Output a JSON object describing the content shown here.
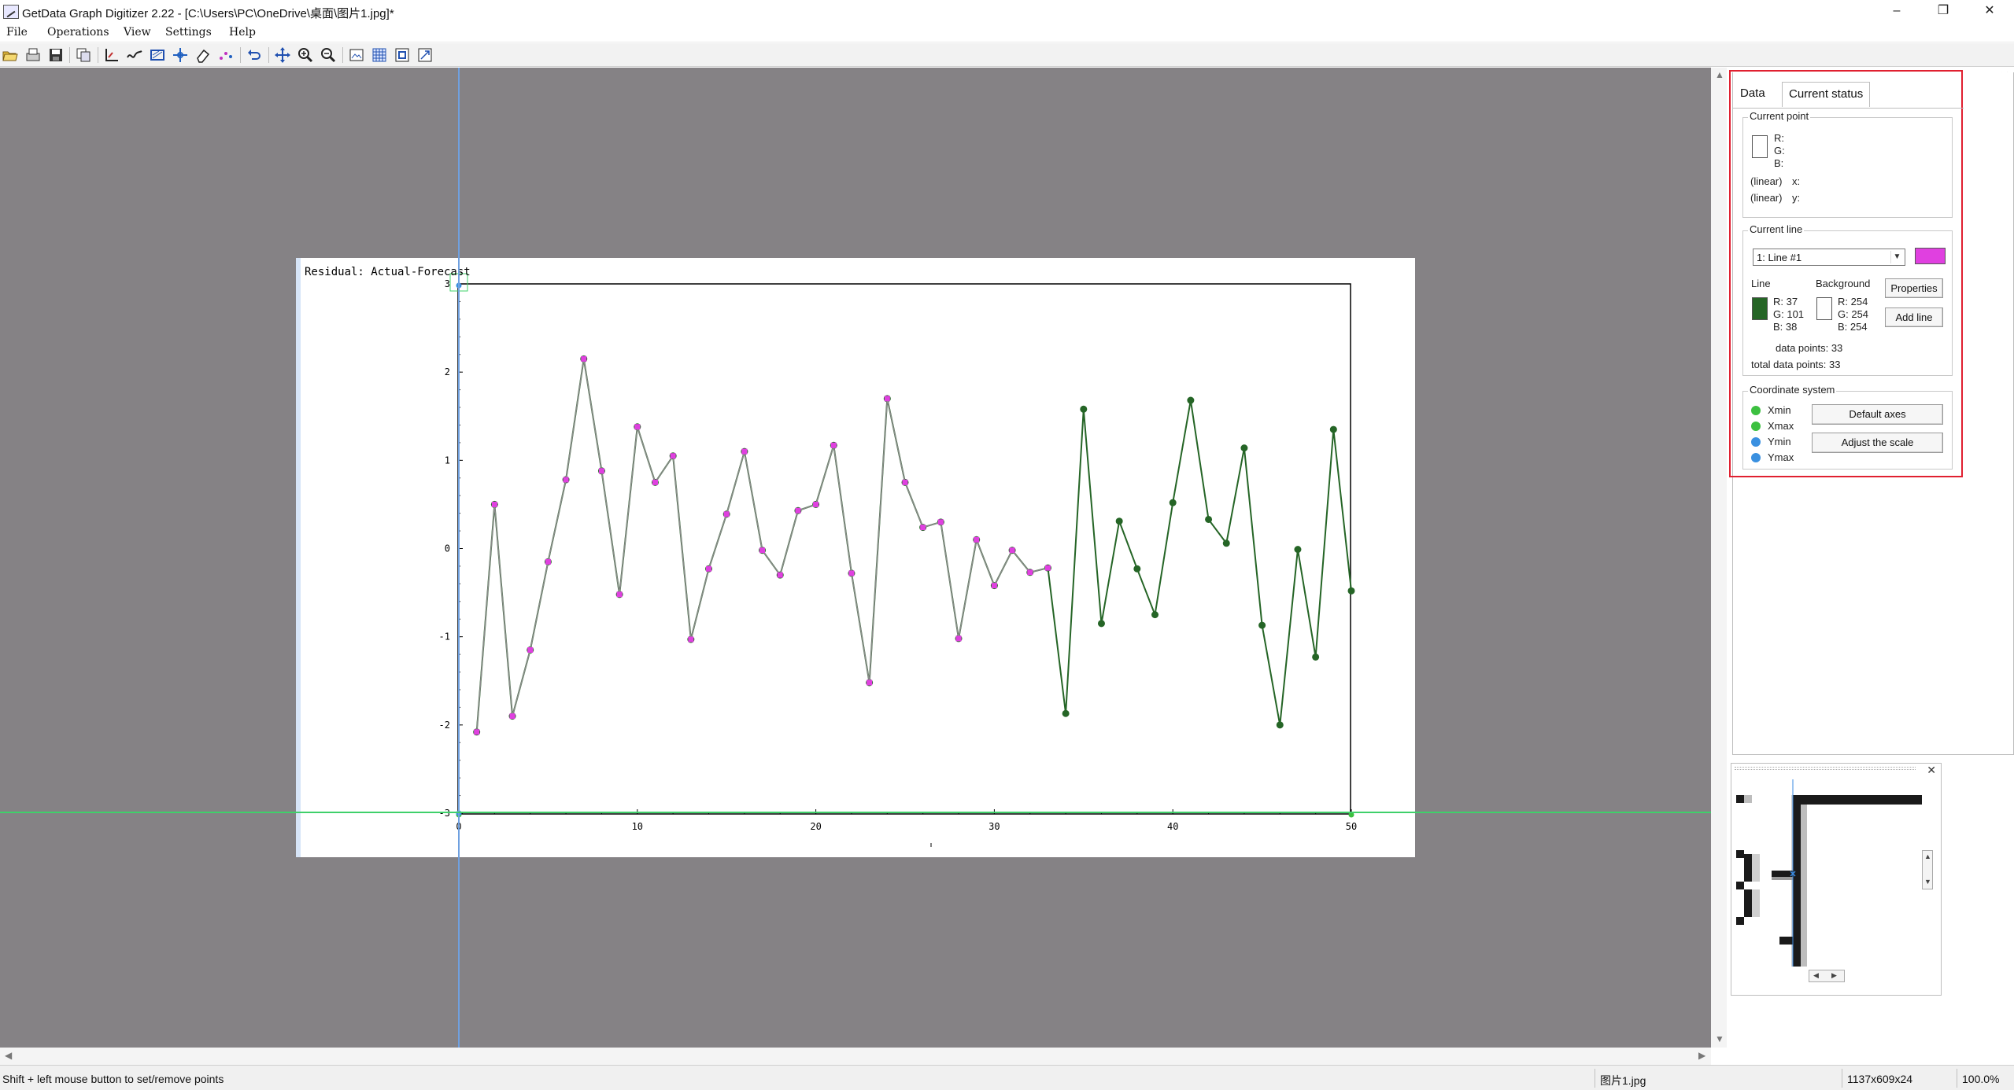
{
  "window": {
    "title": "GetData Graph Digitizer 2.22 - [C:\\Users\\PC\\OneDrive\\桌面\\图片1.jpg]*",
    "controls": {
      "minimize": "–",
      "restore": "❐",
      "close": "✕"
    }
  },
  "menu": {
    "file": "File",
    "operations": "Operations",
    "view": "View",
    "settings": "Settings",
    "help": "Help"
  },
  "toolbar": {
    "icons": [
      "open-icon",
      "scan-icon",
      "save-icon",
      "copy-icon",
      "axes-icon",
      "line-digitize-icon",
      "area-icon",
      "point-icon",
      "eraser-icon",
      "sort-icon",
      "undo-icon",
      "pan-icon",
      "zoom-in-icon",
      "zoom-out-icon",
      "image-icon",
      "grid-icon",
      "fit-icon",
      "resize-icon"
    ]
  },
  "plot": {
    "title": "Residual: Actual-Forecast"
  },
  "chart_data": {
    "type": "line",
    "title": "Residual: Actual-Forecast",
    "xlabel": "",
    "ylabel": "",
    "xlim": [
      0,
      50
    ],
    "ylim": [
      -3,
      3
    ],
    "x_ticks": [
      0,
      10,
      20,
      30,
      40,
      50
    ],
    "y_ticks": [
      -3,
      -2,
      -1,
      0,
      1,
      2,
      3
    ],
    "grid": false,
    "x": [
      1,
      2,
      3,
      4,
      5,
      6,
      7,
      8,
      9,
      10,
      11,
      12,
      13,
      14,
      15,
      16,
      17,
      18,
      19,
      20,
      21,
      22,
      23,
      24,
      25,
      26,
      27,
      28,
      29,
      30,
      31,
      32,
      33,
      34,
      35,
      36,
      37,
      38,
      39,
      40,
      41,
      42,
      43,
      44,
      45,
      46,
      47,
      48,
      49,
      50
    ],
    "series": [
      {
        "values": [
          -2.08,
          0.5,
          -1.9,
          -1.15,
          -0.15,
          0.78,
          2.15,
          0.88,
          -0.52,
          1.38,
          0.75,
          1.05,
          -1.03,
          -0.23,
          0.39,
          1.1,
          -0.02,
          -0.3,
          0.43,
          0.5,
          1.17,
          -0.28,
          -1.52,
          1.7,
          0.75,
          0.24,
          0.3,
          -1.02,
          0.1,
          -0.42,
          -0.02,
          -0.27,
          -0.22,
          -1.87,
          1.58,
          -0.85,
          0.31,
          -0.23,
          -0.75,
          0.52,
          1.68,
          0.33,
          0.06,
          1.14,
          -0.87,
          -2.0,
          -0.01,
          -1.23,
          1.35,
          -0.48
        ],
        "line_color": "#256526"
      }
    ],
    "digitized_points_x": [
      0,
      1,
      2,
      3,
      4,
      5,
      6,
      7,
      8,
      9,
      10,
      11,
      12,
      13,
      14,
      15,
      16,
      17,
      18,
      19,
      20,
      21,
      22,
      23,
      24,
      25,
      26,
      27,
      28,
      29,
      30,
      31,
      32
    ],
    "digitized_points_color": "#e040e0",
    "axis_points": {
      "xmin": 0,
      "xmax": 50,
      "ymin": -3,
      "ymax": 3
    }
  },
  "panel": {
    "tab_data": "Data",
    "tab_status": "Current status",
    "current_point": {
      "title": "Current point",
      "r": "R:",
      "g": "G:",
      "b": "B:",
      "x_label": "(linear)",
      "x_axis": "x:",
      "y_label": "(linear)",
      "y_axis": "y:"
    },
    "current_line": {
      "title": "Current line",
      "selected": "1: Line #1",
      "swatch_color": "#e040e0",
      "line_label": "Line",
      "background_label": "Background",
      "line_r": "R: 37",
      "line_g": "G: 101",
      "line_b": "B: 38",
      "line_color": "#256526",
      "bg_r": "R: 254",
      "bg_g": "G: 254",
      "bg_b": "B: 254",
      "bg_color": "#fefefe",
      "properties_button": "Properties",
      "add_line_button": "Add line",
      "data_points": "data points:  33",
      "total_data_points": "total data points:  33"
    },
    "coordinate_system": {
      "title": "Coordinate system",
      "xmin": "Xmin",
      "xmax": "Xmax",
      "ymin": "Ymin",
      "ymax": "Ymax",
      "x_color": "#3cc040",
      "y_color": "#3a90e0",
      "default_axes_button": "Default axes",
      "adjust_scale_button": "Adjust the scale"
    }
  },
  "statusbar": {
    "hint": "Shift + left mouse button to set/remove points",
    "file": "图片1.jpg",
    "size": "1137x609x24",
    "zoom": "100.0%"
  }
}
